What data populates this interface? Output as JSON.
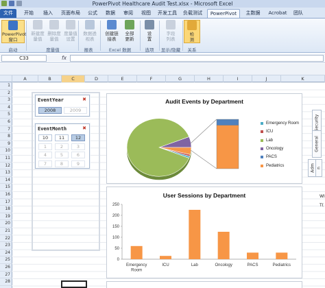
{
  "window": {
    "title": "PowerPivot Healthcare Audit Test.xlsx - Microsoft Excel"
  },
  "ribbon": {
    "tabs": [
      "文件",
      "开始",
      "插入",
      "页面布局",
      "公式",
      "数据",
      "审阅",
      "视图",
      "开发工具",
      "负载测试",
      "PowerPivot",
      "主数据",
      "Acrobat",
      "团队"
    ],
    "active_tab": "PowerPivot",
    "groups": {
      "launch": {
        "label": "启动",
        "buttons": [
          "PowerPivot\n窗口"
        ]
      },
      "measures": {
        "label": "度量值",
        "buttons": [
          "新建度\n量值",
          "删除度\n量值",
          "度量值\n设置"
        ]
      },
      "report": {
        "label": "报表",
        "buttons": [
          "数据透\n视表"
        ]
      },
      "excel_data": {
        "label": "Excel 数据",
        "buttons": [
          "创建链\n接表",
          "全部\n更新"
        ]
      },
      "options": {
        "label": "选项",
        "buttons": [
          "设\n置"
        ]
      },
      "show_hide": {
        "label": "显示/隐藏",
        "buttons": [
          "字段\n列表"
        ]
      },
      "relations": {
        "label": "关系",
        "buttons": [
          "检\n测"
        ]
      }
    }
  },
  "formula_bar": {
    "name_box": "C33",
    "fx": "fx",
    "value": ""
  },
  "columns": [
    "A",
    "B",
    "C",
    "D",
    "E",
    "F",
    "G",
    "H",
    "I",
    "J",
    "K"
  ],
  "selected_column": "C",
  "rows": [
    "1",
    "2",
    "3",
    "4",
    "5",
    "6",
    "7",
    "8",
    "9",
    "10",
    "11",
    "12",
    "13",
    "14",
    "15",
    "16",
    "17",
    "18",
    "19",
    "20",
    "21",
    "22",
    "23",
    "24",
    "25",
    "26",
    "27",
    "28"
  ],
  "slicers": {
    "year": {
      "title": "EventYear",
      "items": [
        {
          "label": "2008",
          "state": "selected"
        },
        {
          "label": "2009",
          "state": "nodata"
        }
      ]
    },
    "month": {
      "title": "EventMonth",
      "items": [
        {
          "label": "10",
          "state": "normal"
        },
        {
          "label": "11",
          "state": "normal"
        },
        {
          "label": "12",
          "state": "selected"
        },
        {
          "label": "1",
          "state": "nodata"
        },
        {
          "label": "2",
          "state": "nodata"
        },
        {
          "label": "3",
          "state": "nodata"
        },
        {
          "label": "4",
          "state": "nodata"
        },
        {
          "label": "5",
          "state": "nodata"
        },
        {
          "label": "6",
          "state": "nodata"
        },
        {
          "label": "7",
          "state": "nodata"
        },
        {
          "label": "8",
          "state": "nodata"
        },
        {
          "label": "9",
          "state": "nodata"
        }
      ]
    }
  },
  "chart_data": [
    {
      "type": "pie",
      "title": "Audit Events by Department",
      "categories": [
        "Emergency Room",
        "ICU",
        "Lab",
        "Oncology",
        "PACS",
        "Pediatrics"
      ],
      "values": [
        1,
        1,
        88,
        6,
        0,
        4
      ],
      "colors": [
        "#4bacc6",
        "#c0504d",
        "#9bbb59",
        "#8064a2",
        "#4f81bd",
        "#f79646"
      ],
      "breakout": {
        "categories": [
          "Emergency Room",
          "ICU",
          "Lab",
          "Oncology",
          "PACS",
          "Pediatrics"
        ],
        "values": [
          0,
          0,
          0,
          0,
          12,
          88
        ]
      },
      "legend_position": "right"
    },
    {
      "type": "bar",
      "title": "User Sessions by Department",
      "categories": [
        "Emergency Room",
        "ICU",
        "Lab",
        "Oncology",
        "PACS",
        "Pediatrics"
      ],
      "values": [
        60,
        15,
        225,
        125,
        30,
        30
      ],
      "color": "#f79646",
      "ylim": [
        0,
        250
      ],
      "yticks": [
        "0",
        "50",
        "100",
        "150",
        "200",
        "250"
      ],
      "grid": false
    }
  ],
  "side_tabs": {
    "security": "Security",
    "general": "General",
    "adm": "Adm",
    "n": "n"
  },
  "right_text": {
    "w": "WI",
    "t": "T("
  }
}
